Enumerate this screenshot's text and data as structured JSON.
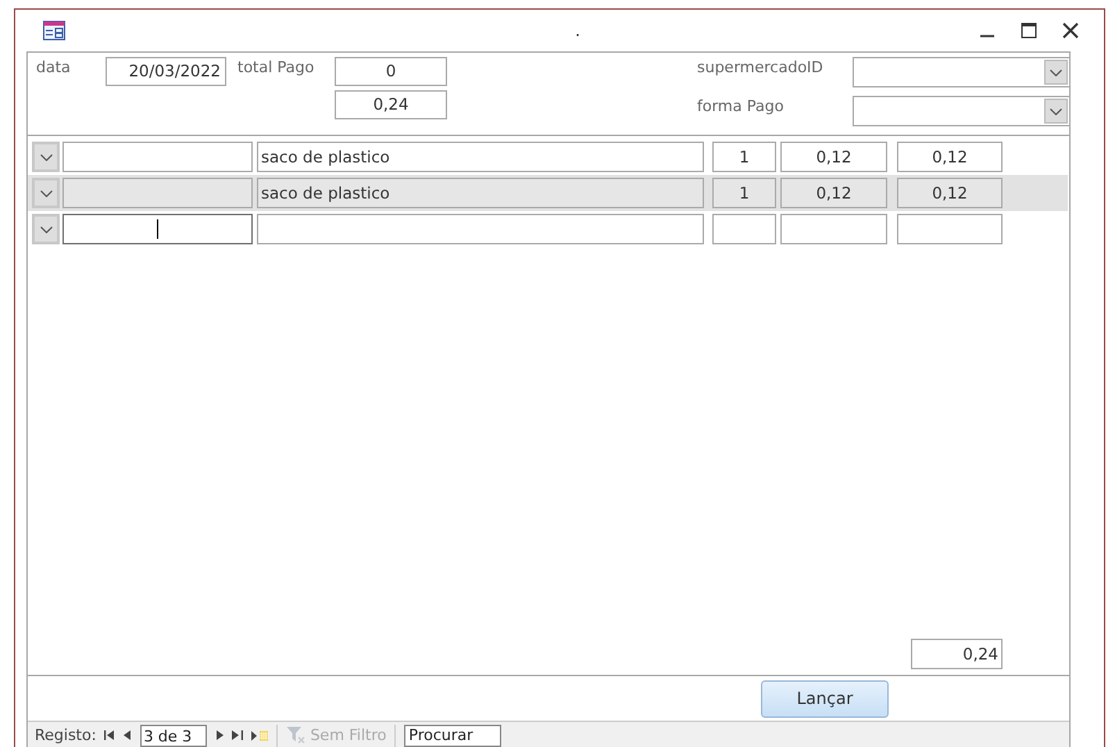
{
  "window": {
    "title": "."
  },
  "header": {
    "data_label": "data",
    "data_value": "20/03/2022",
    "total_label": "total Pago",
    "total_value": "0",
    "sum_value": "0,24",
    "supermercado_label": "supermercadoID",
    "forma_label": "forma Pago"
  },
  "rows": [
    {
      "code": "",
      "description": "saco de plastico",
      "quantity": "1",
      "price": "0,12",
      "total": "0,12",
      "shaded": false,
      "focused": false
    },
    {
      "code": "",
      "description": "saco de plastico",
      "quantity": "1",
      "price": "0,12",
      "total": "0,12",
      "shaded": true,
      "focused": false
    },
    {
      "code": "",
      "description": "",
      "quantity": "",
      "price": "",
      "total": "",
      "shaded": false,
      "focused": true
    }
  ],
  "subform_total": "0,24",
  "launch_button": "Lançar",
  "navigation": {
    "label": "Registo:",
    "position": "3 de 3",
    "filter": {
      "label": "Sem Filtro",
      "disabled": true
    },
    "search": {
      "placeholder": "Procurar"
    }
  }
}
